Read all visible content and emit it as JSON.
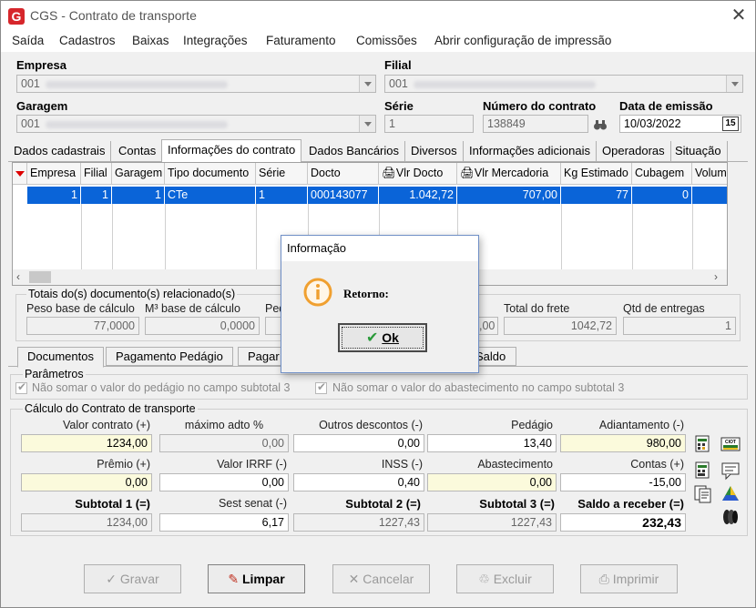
{
  "window": {
    "title": "CGS - Contrato de transporte"
  },
  "menu": [
    "Saída",
    "Cadastros",
    "Baixas",
    "Integrações",
    "Faturamento",
    "Comissões",
    "Abrir configuração de impressão"
  ],
  "header": {
    "empresa_label": "Empresa",
    "empresa_value": "001",
    "filial_label": "Filial",
    "filial_value": "001",
    "garagem_label": "Garagem",
    "garagem_value": "001",
    "serie_label": "Série",
    "serie_value": "1",
    "numero_label": "Número do contrato",
    "numero_value": "138849",
    "data_label": "Data de emissão",
    "data_value": "10/03/2022",
    "cal_btn": "15"
  },
  "tabs": [
    "Dados cadastrais",
    "Contas",
    "Informações do contrato",
    "Dados Bancários",
    "Diversos",
    "Informações adicionais",
    "Operadoras",
    "Situação"
  ],
  "grid": {
    "columns": [
      "Empresa",
      "Filial",
      "Garagem",
      "Tipo documento",
      "Série",
      "Docto",
      "Vlr Docto",
      "Vlr Mercadoria",
      "Kg Estimado",
      "Cubagem",
      "Volum"
    ],
    "row": [
      "1",
      "1",
      "1",
      "CTe",
      "1",
      "000143077",
      "1.042,72",
      "707,00",
      "77",
      "0",
      ""
    ]
  },
  "totais": {
    "title": "Totais do(s) documento(s) relacionado(s)",
    "peso_label": "Peso base de cálculo",
    "peso_value": "77,0000",
    "m3_label": "M³ base de cálculo",
    "m3_value": "0,0000",
    "ped_label": "Ped",
    "hidden_value": ",00",
    "frete_label": "Total do frete",
    "frete_value": "1042,72",
    "entregas_label": "Qtd de entregas",
    "entregas_value": "1"
  },
  "subtabs": [
    "Documentos",
    "Pagamento Pedágio",
    "Pagar",
    "Saldo"
  ],
  "parametros": {
    "title": "Parâmetros",
    "opt1": "Não somar o valor do pedágio no campo subtotal 3",
    "opt2": "Não somar o valor do abastecimento no campo subtotal 3"
  },
  "calculo": {
    "title": "Cálculo do Contrato de transporte",
    "valor_contrato_label": "Valor contrato (+)",
    "valor_contrato": "1234,00",
    "max_adto_label": "máximo adto %",
    "max_adto": "0,00",
    "outros_desc_label": "Outros descontos (-)",
    "outros_desc": "0,00",
    "pedagio_label": "Pedágio",
    "pedagio": "13,40",
    "adiantamento_label": "Adiantamento (-)",
    "adiantamento": "980,00",
    "premio_label": "Prêmio (+)",
    "premio": "0,00",
    "irrf_label": "Valor IRRF (-)",
    "irrf": "0,00",
    "inss_label": "INSS (-)",
    "inss": "0,40",
    "abastecimento_label": "Abastecimento",
    "abastecimento": "0,00",
    "contas_label": "Contas (+)",
    "contas": "-15,00",
    "subtotal1_label": "Subtotal 1 (=)",
    "subtotal1": "1234,00",
    "sest_label": "Sest senat (-)",
    "sest": "6,17",
    "subtotal2_label": "Subtotal 2 (=)",
    "subtotal2": "1227,43",
    "subtotal3_label": "Subtotal 3 (=)",
    "subtotal3": "1227,43",
    "saldo_label": "Saldo a receber (=)",
    "saldo": "232,43",
    "ciot_label": "CIOT"
  },
  "buttons": {
    "gravar": "Gravar",
    "limpar": "Limpar",
    "cancelar": "Cancelar",
    "excluir": "Excluir",
    "imprimir": "Imprimir"
  },
  "dialog": {
    "title": "Informação",
    "message": "Retorno:",
    "ok": "Ok"
  },
  "colors": {
    "accent": "#0a64d8",
    "yellow_field": "#fbfadc",
    "dialog_icon": "#f0a030"
  }
}
